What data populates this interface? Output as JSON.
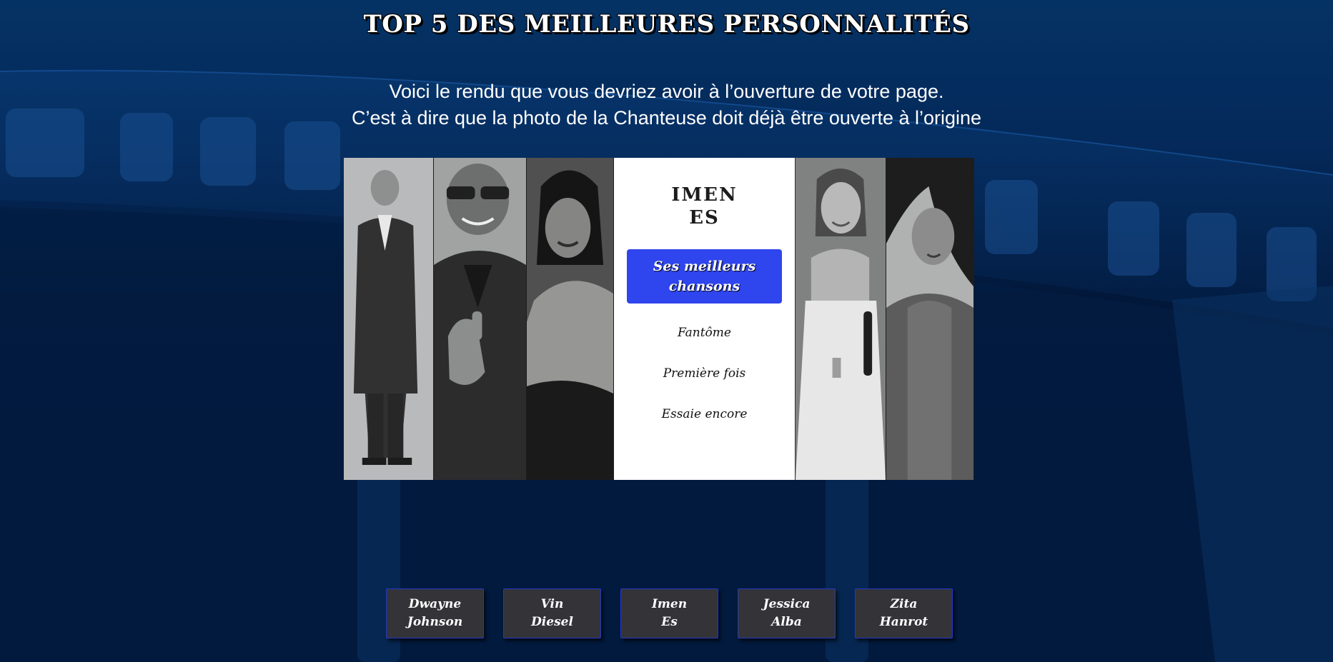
{
  "header": {
    "title": "TOP 5 DES MEILLEURES PERSONNALITÉS",
    "intro_line1": "Voici le rendu que vous devriez avoir à l’ouverture de votre page.",
    "intro_line2": "C’est à dire que la photo de la Chanteuse doit déjà être ouverte à l’origine"
  },
  "gallery": {
    "open_panel": {
      "name_line1": "IMEN",
      "name_line2": "ES",
      "button_label": "Ses meilleurs chansons",
      "songs": [
        "Fantôme",
        "Première fois",
        "Essaie encore"
      ]
    },
    "photos": [
      {
        "person": "Dwayne Johnson",
        "tone": "#a9adb6"
      },
      {
        "person": "Vin Diesel",
        "tone": "#6f7378"
      },
      {
        "person": "Imen Es",
        "tone": "#3b3b3e"
      },
      {
        "person": "Jessica Alba",
        "tone": "#c9ccd0"
      },
      {
        "person": "Zita Hanrot",
        "tone": "#8e9196"
      }
    ]
  },
  "nav": [
    {
      "line1": "Dwayne",
      "line2": "Johnson"
    },
    {
      "line1": "Vin",
      "line2": "Diesel"
    },
    {
      "line1": "Imen",
      "line2": "Es"
    },
    {
      "line1": "Jessica",
      "line2": "Alba"
    },
    {
      "line1": "Zita",
      "line2": "Hanrot"
    }
  ],
  "colors": {
    "accent_button": "#2f45ee",
    "nav_button_bg": "#333338",
    "nav_button_border": "#2239c9",
    "background_top": "#053264",
    "background_bottom": "#011535"
  }
}
